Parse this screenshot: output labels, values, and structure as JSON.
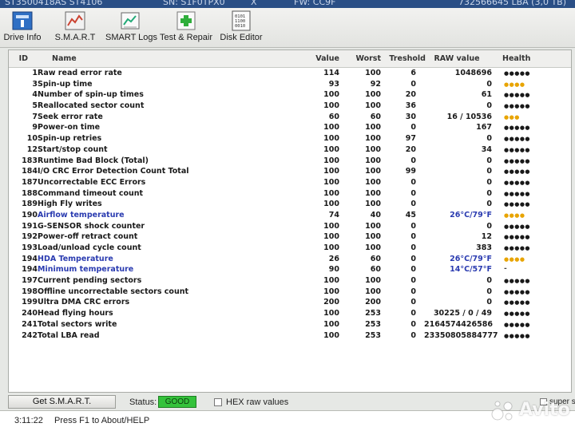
{
  "top_strip": {
    "left_text": "ST3500418AS ST4106",
    "sn_text": "SN: S1F0TPX0",
    "close_mark": "X",
    "fw_text": "FW: CC9F",
    "lba_text": "732566645 LBA (3,0 TB)"
  },
  "toolbar": {
    "buttons": [
      {
        "label": "Drive Info",
        "icon": "drive-info-icon"
      },
      {
        "label": "S.M.A.R.T",
        "icon": "smart-icon"
      },
      {
        "label": "SMART Logs",
        "icon": "smart-logs-icon"
      },
      {
        "label": "Test & Repair",
        "icon": "test-repair-icon"
      },
      {
        "label": "Disk Editor",
        "icon": "disk-editor-icon"
      }
    ]
  },
  "table": {
    "headers": {
      "id": "ID",
      "name": "Name",
      "value": "Value",
      "worst": "Worst",
      "threshold": "Treshold",
      "raw": "RAW value",
      "health": "Health"
    },
    "rows": [
      {
        "id": "1",
        "name": "Raw read error rate",
        "value": "114",
        "worst": "100",
        "threshold": "6",
        "raw": "1048696",
        "health": "●●●●●",
        "health_level": "ok",
        "highlight": false
      },
      {
        "id": "3",
        "name": "Spin-up time",
        "value": "93",
        "worst": "92",
        "threshold": "0",
        "raw": "0",
        "health": "●●●●",
        "health_level": "warn",
        "highlight": false
      },
      {
        "id": "4",
        "name": "Number of spin-up times",
        "value": "100",
        "worst": "100",
        "threshold": "20",
        "raw": "61",
        "health": "●●●●●",
        "health_level": "ok",
        "highlight": false
      },
      {
        "id": "5",
        "name": "Reallocated sector count",
        "value": "100",
        "worst": "100",
        "threshold": "36",
        "raw": "0",
        "health": "●●●●●",
        "health_level": "ok",
        "highlight": false
      },
      {
        "id": "7",
        "name": "Seek error rate",
        "value": "60",
        "worst": "60",
        "threshold": "30",
        "raw": "16 / 10536",
        "health": "●●●",
        "health_level": "warn",
        "highlight": false
      },
      {
        "id": "9",
        "name": "Power-on time",
        "value": "100",
        "worst": "100",
        "threshold": "0",
        "raw": "167",
        "health": "●●●●●",
        "health_level": "ok",
        "highlight": false
      },
      {
        "id": "10",
        "name": "Spin-up retries",
        "value": "100",
        "worst": "100",
        "threshold": "97",
        "raw": "0",
        "health": "●●●●●",
        "health_level": "ok",
        "highlight": false
      },
      {
        "id": "12",
        "name": "Start/stop count",
        "value": "100",
        "worst": "100",
        "threshold": "20",
        "raw": "34",
        "health": "●●●●●",
        "health_level": "ok",
        "highlight": false
      },
      {
        "id": "183",
        "name": "Runtime Bad Block (Total)",
        "value": "100",
        "worst": "100",
        "threshold": "0",
        "raw": "0",
        "health": "●●●●●",
        "health_level": "ok",
        "highlight": false
      },
      {
        "id": "184",
        "name": "I/O CRC Error Detection Count Total",
        "value": "100",
        "worst": "100",
        "threshold": "99",
        "raw": "0",
        "health": "●●●●●",
        "health_level": "ok",
        "highlight": false
      },
      {
        "id": "187",
        "name": "Uncorrectable ECC Errors",
        "value": "100",
        "worst": "100",
        "threshold": "0",
        "raw": "0",
        "health": "●●●●●",
        "health_level": "ok",
        "highlight": false
      },
      {
        "id": "188",
        "name": "Command timeout count",
        "value": "100",
        "worst": "100",
        "threshold": "0",
        "raw": "0",
        "health": "●●●●●",
        "health_level": "ok",
        "highlight": false
      },
      {
        "id": "189",
        "name": "High Fly writes",
        "value": "100",
        "worst": "100",
        "threshold": "0",
        "raw": "0",
        "health": "●●●●●",
        "health_level": "ok",
        "highlight": false
      },
      {
        "id": "190",
        "name": "Airflow temperature",
        "value": "74",
        "worst": "40",
        "threshold": "45",
        "raw": "26°C/79°F",
        "health": "●●●●",
        "health_level": "warn",
        "highlight": true
      },
      {
        "id": "191",
        "name": "G-SENSOR shock counter",
        "value": "100",
        "worst": "100",
        "threshold": "0",
        "raw": "0",
        "health": "●●●●●",
        "health_level": "ok",
        "highlight": false
      },
      {
        "id": "192",
        "name": "Power-off retract count",
        "value": "100",
        "worst": "100",
        "threshold": "0",
        "raw": "12",
        "health": "●●●●●",
        "health_level": "ok",
        "highlight": false
      },
      {
        "id": "193",
        "name": "Load/unload cycle count",
        "value": "100",
        "worst": "100",
        "threshold": "0",
        "raw": "383",
        "health": "●●●●●",
        "health_level": "ok",
        "highlight": false
      },
      {
        "id": "194",
        "name": "HDA Temperature",
        "value": "26",
        "worst": "60",
        "threshold": "0",
        "raw": "26°C/79°F",
        "health": "●●●●",
        "health_level": "warn",
        "highlight": true
      },
      {
        "id": "194",
        "name": "Minimum temperature",
        "value": "90",
        "worst": "60",
        "threshold": "0",
        "raw": "14°C/57°F",
        "health": "-",
        "health_level": "dash",
        "highlight": true
      },
      {
        "id": "197",
        "name": "Current pending sectors",
        "value": "100",
        "worst": "100",
        "threshold": "0",
        "raw": "0",
        "health": "●●●●●",
        "health_level": "ok",
        "highlight": false
      },
      {
        "id": "198",
        "name": "Offline uncorrectable sectors count",
        "value": "100",
        "worst": "100",
        "threshold": "0",
        "raw": "0",
        "health": "●●●●●",
        "health_level": "ok",
        "highlight": false
      },
      {
        "id": "199",
        "name": "Ultra DMA CRC errors",
        "value": "200",
        "worst": "200",
        "threshold": "0",
        "raw": "0",
        "health": "●●●●●",
        "health_level": "ok",
        "highlight": false
      },
      {
        "id": "240",
        "name": "Head flying hours",
        "value": "100",
        "worst": "253",
        "threshold": "0",
        "raw": "30225 / 0 / 49",
        "health": "●●●●●",
        "health_level": "ok",
        "highlight": false
      },
      {
        "id": "241",
        "name": "Total sectors write",
        "value": "100",
        "worst": "253",
        "threshold": "0",
        "raw": "2164574426586",
        "health": "●●●●●",
        "health_level": "ok",
        "highlight": false
      },
      {
        "id": "242",
        "name": "Total LBA read",
        "value": "100",
        "worst": "253",
        "threshold": "0",
        "raw": "23350805884777",
        "health": "●●●●●",
        "health_level": "ok",
        "highlight": false
      }
    ]
  },
  "bottom": {
    "get_smart_label": "Get S.M.A.R.T.",
    "status_label": "Status:",
    "status_value": "GOOD",
    "hex_label": "HEX raw values",
    "super_label": "super s"
  },
  "log": {
    "time": "3:11:22",
    "message": "Press F1 to About/HELP"
  },
  "watermark": {
    "text": "Avito"
  },
  "colors": {
    "status_good": "#34c23b",
    "highlight_text": "#2a3bb0",
    "warn_dots": "#e8a400"
  }
}
